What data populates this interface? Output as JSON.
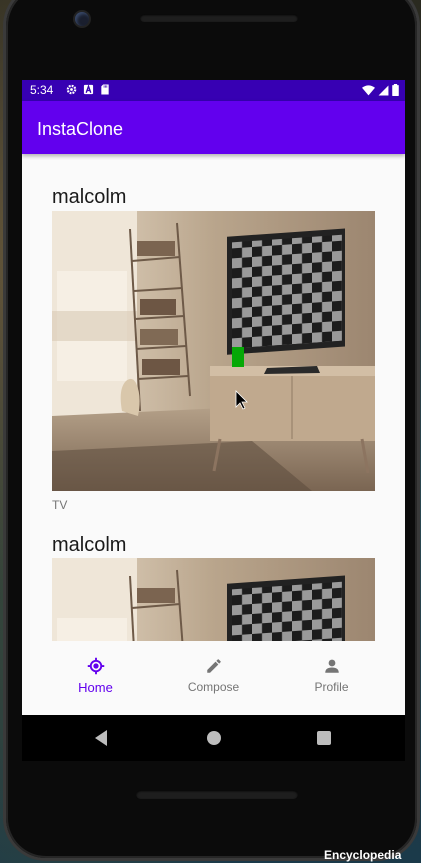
{
  "status_bar": {
    "time": "5:34",
    "left_icons": [
      "settings-icon",
      "a-badge-icon",
      "sd-card-icon"
    ],
    "right_icons": [
      "wifi-icon",
      "signal-icon",
      "battery-icon"
    ]
  },
  "app_bar": {
    "title": "InstaClone"
  },
  "feed": {
    "posts": [
      {
        "username": "malcolm",
        "caption": "TV"
      },
      {
        "username": "malcolm",
        "caption": ""
      }
    ]
  },
  "bottom_nav": {
    "items": [
      {
        "label": "Home",
        "icon": "home-target-icon",
        "active": true
      },
      {
        "label": "Compose",
        "icon": "pencil-icon",
        "active": false
      },
      {
        "label": "Profile",
        "icon": "person-icon",
        "active": false
      }
    ]
  },
  "desktop": {
    "taskbar_text": "Encyclopedia"
  },
  "colors": {
    "status_bar": "#3700b3",
    "app_bar": "#6200ee",
    "accent": "#6200ee",
    "inactive": "#757575"
  }
}
